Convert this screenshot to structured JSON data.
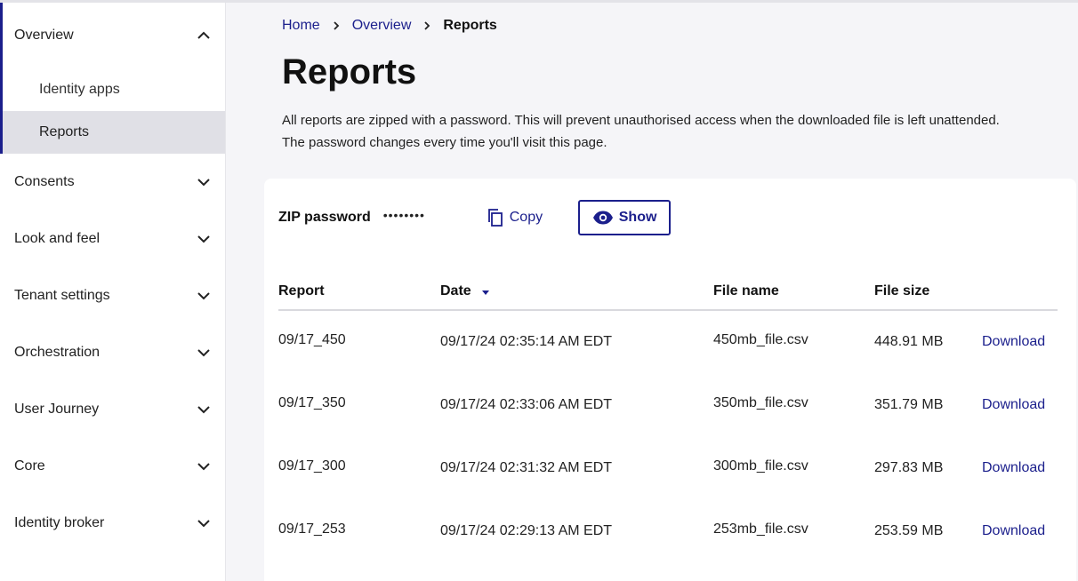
{
  "sidebar": {
    "overview": {
      "label": "Overview",
      "items": [
        {
          "label": "Identity apps"
        },
        {
          "label": "Reports"
        }
      ]
    },
    "groups": [
      {
        "label": "Consents"
      },
      {
        "label": "Look and feel"
      },
      {
        "label": "Tenant settings"
      },
      {
        "label": "Orchestration"
      },
      {
        "label": "User Journey"
      },
      {
        "label": "Core"
      },
      {
        "label": "Identity broker"
      }
    ]
  },
  "breadcrumb": [
    "Home",
    "Overview",
    "Reports"
  ],
  "page": {
    "title": "Reports",
    "description_line1": "All reports are zipped with a password. This will prevent unauthorised access when the downloaded file is left unattended.",
    "description_line2": "The password changes every time you'll visit this page."
  },
  "password": {
    "label": "ZIP password",
    "masked_value": "••••••••",
    "copy_label": "Copy",
    "show_label": "Show"
  },
  "table": {
    "headers": [
      "Report",
      "Date",
      "File name",
      "File size"
    ],
    "rows": [
      {
        "report": "09/17_450",
        "date": "09/17/24 02:35:14 AM EDT",
        "file": "450mb_file.csv",
        "size": "448.91 MB",
        "action": "Download"
      },
      {
        "report": "09/17_350",
        "date": "09/17/24 02:33:06 AM EDT",
        "file": "350mb_file.csv",
        "size": "351.79 MB",
        "action": "Download"
      },
      {
        "report": "09/17_300",
        "date": "09/17/24 02:31:32 AM EDT",
        "file": "300mb_file.csv",
        "size": "297.83 MB",
        "action": "Download"
      },
      {
        "report": "09/17_253",
        "date": "09/17/24 02:29:13 AM EDT",
        "file": "253mb_file.csv",
        "size": "253.59 MB",
        "action": "Download"
      }
    ]
  },
  "colors": {
    "accent": "#1b1f8c",
    "active_bg": "#e0e0e6",
    "page_bg": "#f5f5f8"
  }
}
